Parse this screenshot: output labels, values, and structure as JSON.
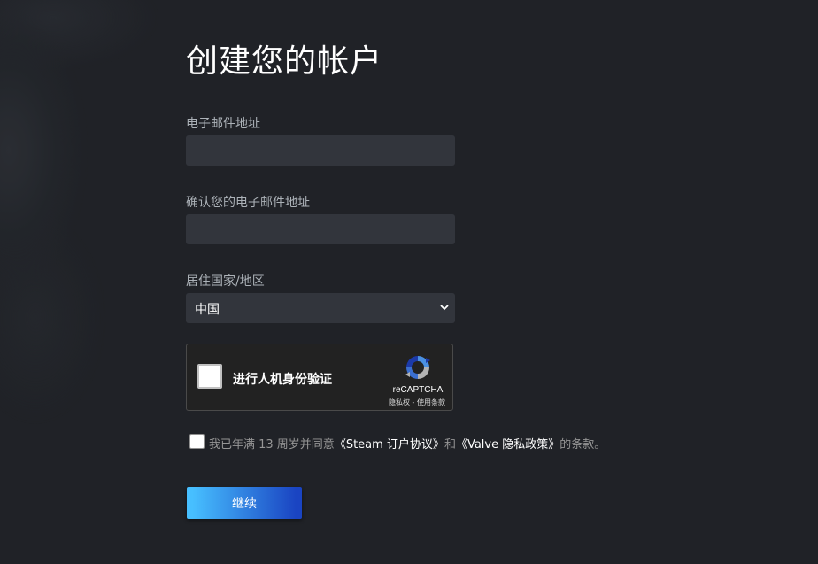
{
  "page_title": "创建您的帐户",
  "email": {
    "label": "电子邮件地址",
    "value": ""
  },
  "confirm_email": {
    "label": "确认您的电子邮件地址",
    "value": ""
  },
  "country": {
    "label": "居住国家/地区",
    "selected": "中国"
  },
  "recaptcha": {
    "label": "进行人机身份验证",
    "brand": "reCAPTCHA",
    "links": "隐私权 - 使用条款",
    "checked": false
  },
  "agreement": {
    "prefix": "我已年满 13 周岁并同意",
    "link1": "《Steam 订户协议》",
    "middle": "和",
    "link2": "《Valve 隐私政策》",
    "suffix": "的条款。",
    "checked": false
  },
  "continue_label": "继续",
  "colors": {
    "background": "#202227",
    "input_bg": "#32353c",
    "button_gradient_start": "#47bfff",
    "button_gradient_end": "#1a44c2"
  }
}
